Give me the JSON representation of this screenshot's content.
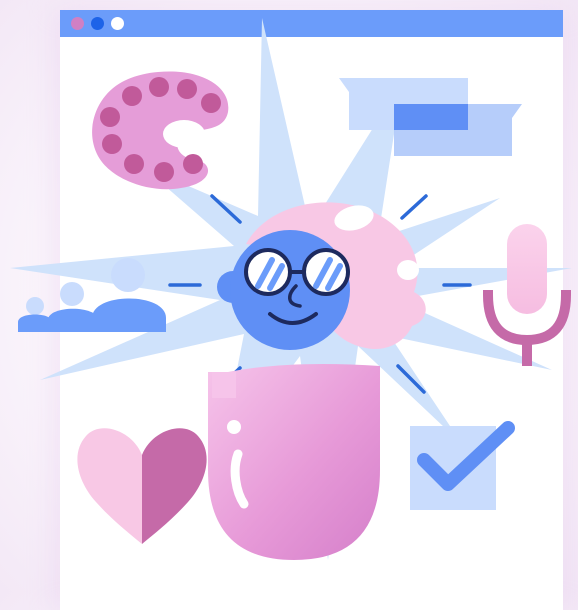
{
  "window": {
    "controls": [
      "close-dot",
      "minimize-dot",
      "maximize-dot"
    ],
    "titlebar_color": "#6b9cfa"
  },
  "illustration": {
    "icons": [
      "paint-palette-icon",
      "chat-bubbles-icon",
      "person-avatar-icon",
      "people-group-icon",
      "microphone-icon",
      "heart-icon",
      "checkbox-checked-icon",
      "capsule-body"
    ],
    "colors": {
      "blue_primary": "#5f8ff5",
      "blue_light": "#cfe2fb",
      "pink_light": "#f9c8e6",
      "pink_mid": "#e49fd7",
      "pink_dark": "#c56aa8",
      "outline": "#1d2a5e"
    }
  }
}
